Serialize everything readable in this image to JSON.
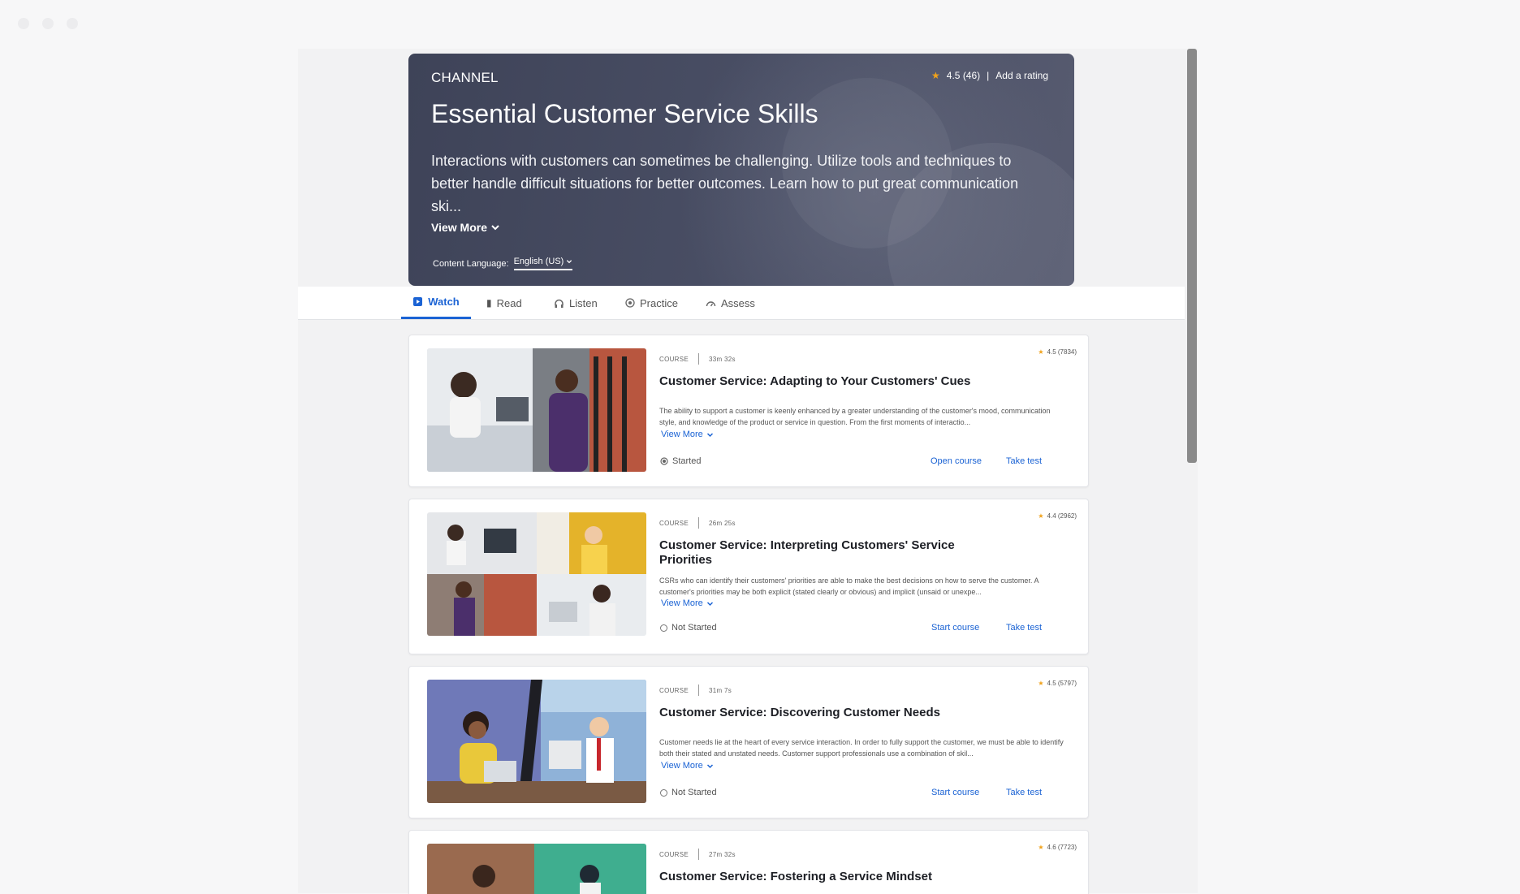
{
  "hero": {
    "kicker": "CHANNEL",
    "title": "Essential Customer Service Skills",
    "description": "Interactions with customers can sometimes be challenging. Utilize tools and techniques to better handle difficult situations for better outcomes. Learn how to put great communication ski...",
    "view_more": "View More",
    "rating": "4.5 (46)",
    "rating_sep": "|",
    "add_rating": "Add a rating",
    "language_label": "Content Language:",
    "language_value": "English (US)"
  },
  "tabs": [
    {
      "label": "Watch",
      "icon": "video-icon",
      "active": true
    },
    {
      "label": "Read",
      "icon": "book-icon"
    },
    {
      "label": "Listen",
      "icon": "headphones-icon"
    },
    {
      "label": "Practice",
      "icon": "target-icon"
    },
    {
      "label": "Assess",
      "icon": "gauge-icon"
    }
  ],
  "courses": [
    {
      "type": "COURSE",
      "duration": "33m 32s",
      "rating": "4.5 (7834)",
      "title": "Customer Service: Adapting to Your Customers' Cues",
      "description": "The ability to support a customer is keenly enhanced by a greater understanding of the customer's mood, communication style, and knowledge of the product or service in question. From the first moments of interactio...",
      "view_more": "View More",
      "status": "Started",
      "primary_action": "Open course",
      "secondary_action": "Take test"
    },
    {
      "type": "COURSE",
      "duration": "26m 25s",
      "rating": "4.4 (2962)",
      "title": "Customer Service: Interpreting Customers' Service Priorities",
      "description": "CSRs who can identify their customers' priorities are able to make the best decisions on how to serve the customer. A customer's priorities may be both explicit (stated clearly or obvious) and implicit (unsaid or unexpe...",
      "view_more": "View More",
      "status": "Not Started",
      "primary_action": "Start course",
      "secondary_action": "Take test"
    },
    {
      "type": "COURSE",
      "duration": "31m 7s",
      "rating": "4.5 (5797)",
      "title": "Customer Service: Discovering Customer Needs",
      "description": "Customer needs lie at the heart of every service interaction. In order to fully support the customer, we must be able to identify both their stated and unstated needs. Customer support professionals use a combination of skil...",
      "view_more": "View More",
      "status": "Not Started",
      "primary_action": "Start course",
      "secondary_action": "Take test"
    },
    {
      "type": "COURSE",
      "duration": "27m 32s",
      "rating": "4.6 (7723)",
      "title": "Customer Service: Fostering a Service Mindset"
    }
  ],
  "colors": {
    "accent": "#1b63d4",
    "star": "#f0a21b",
    "hero_bg": "#454a60"
  }
}
